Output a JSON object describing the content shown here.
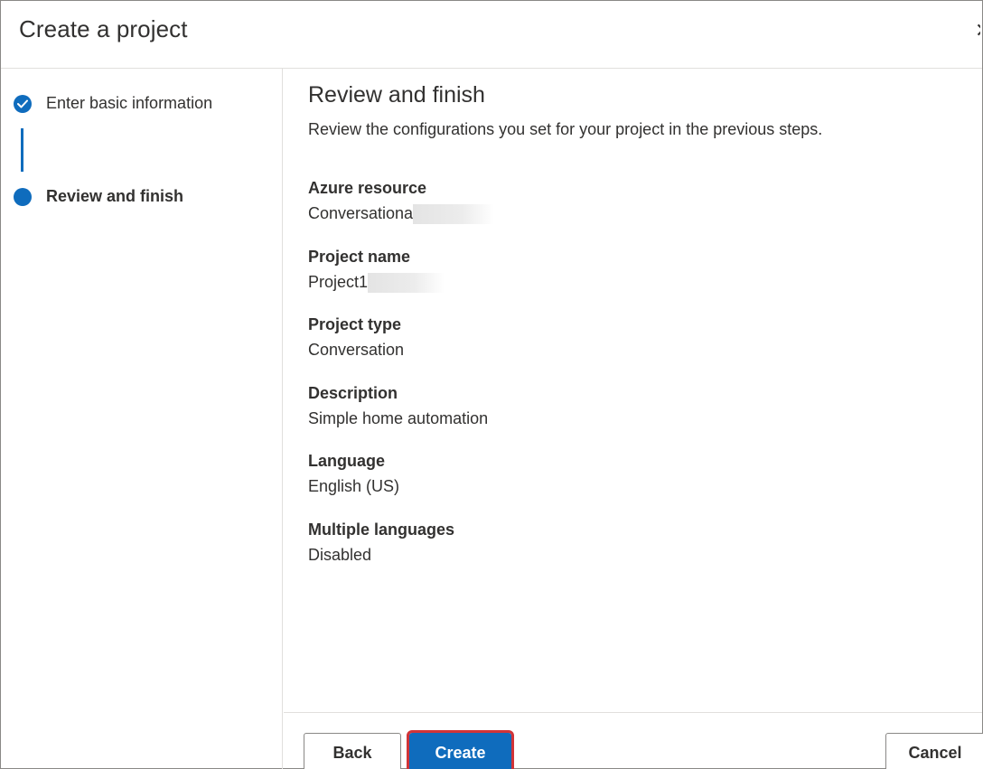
{
  "dialog": {
    "title": "Create a project"
  },
  "stepper": {
    "steps": [
      {
        "label": "Enter basic information",
        "status": "completed"
      },
      {
        "label": "Review and finish",
        "status": "current"
      }
    ]
  },
  "main": {
    "title": "Review and finish",
    "subtitle": "Review the configurations you set for your project in the previous steps.",
    "fields": [
      {
        "label": "Azure resource",
        "value": "Conversationa"
      },
      {
        "label": "Project name",
        "value": "Project1"
      },
      {
        "label": "Project type",
        "value": "Conversation"
      },
      {
        "label": "Description",
        "value": "Simple home automation"
      },
      {
        "label": "Language",
        "value": "English (US)"
      },
      {
        "label": "Multiple languages",
        "value": "Disabled"
      }
    ]
  },
  "footer": {
    "back_label": "Back",
    "create_label": "Create",
    "cancel_label": "Cancel"
  },
  "colors": {
    "accent": "#0f6cbd",
    "highlight": "#d13438"
  }
}
